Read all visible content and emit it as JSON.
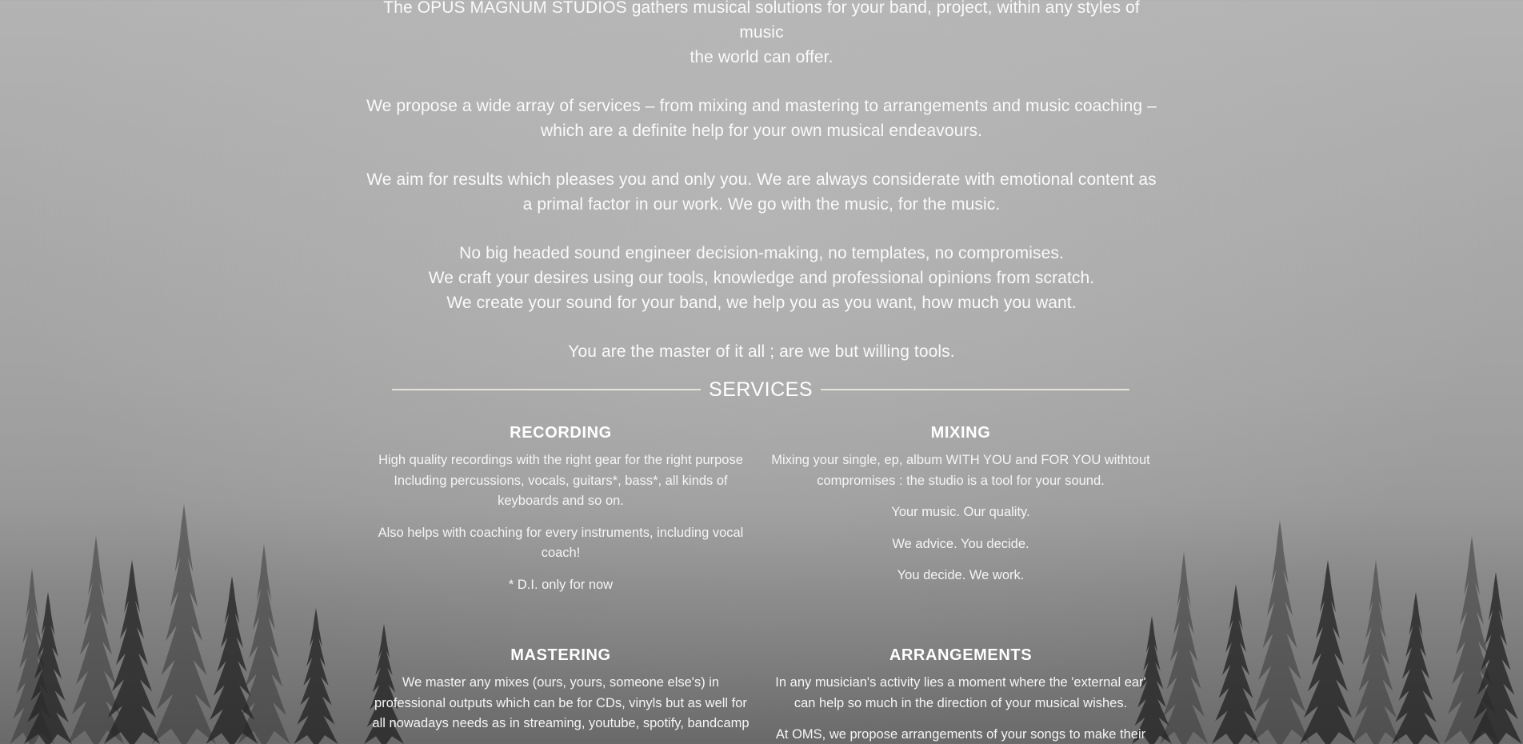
{
  "intro": {
    "paragraphs": [
      "The OPUS MAGNUM STUDIOS gathers musical solutions for your band, project, within any styles of music\nthe world can offer.",
      "We propose a wide array of services – from mixing and mastering to arrangements and music coaching –\nwhich are a definite help for your own musical endeavours.",
      "We aim for results which pleases you and only you. We are always considerate with emotional content as\na primal factor in our work. We go with the music, for the music.",
      "No big headed sound engineer decision-making, no templates, no compromises.\nWe craft your desires using our tools, knowledge and professional opinions from scratch.\nWe create your sound for your band, we help you as you want, how much you want.",
      "You are the master of it all ; are we but willing tools."
    ]
  },
  "services": {
    "title": "SERVICES",
    "recording": {
      "title": "RECORDING",
      "p1": "High quality recordings with the right gear for the right purpose\nIncluding percussions, vocals, guitars*, bass*, all kinds of\nkeyboards and so on.",
      "p2": "Also helps with coaching for every instruments, including vocal\ncoach!",
      "p3": "* D.I. only for now"
    },
    "mixing": {
      "title": "MIXING",
      "p1": "Mixing your single, ep, album WITH YOU and FOR YOU withtout\ncompromises : the studio is a tool for your sound.",
      "p2": "Your music. Our quality.",
      "p3": "We advice. You decide.",
      "p4": "You decide. We work."
    },
    "mastering": {
      "title": "MASTERING",
      "p1": "We master any mixes (ours, yours, someone else's) in\nprofessional outputs which can be for CDs, vinyls but as well for\nall nowadays needs as in streaming, youtube, spotify, bandcamp"
    },
    "arrangements": {
      "title": "ARRANGEMENTS",
      "p1": "In any musician's activity lies a moment where the 'external ear'\ncan help so much in the direction of your musical wishes.",
      "p2": "At OMS, we propose arrangements of your songs to make their"
    }
  },
  "colors": {
    "text": "#ffffff",
    "rule": "#e6e3da",
    "background_top": "#b3b3b3",
    "forest": "#2b2b2b"
  }
}
